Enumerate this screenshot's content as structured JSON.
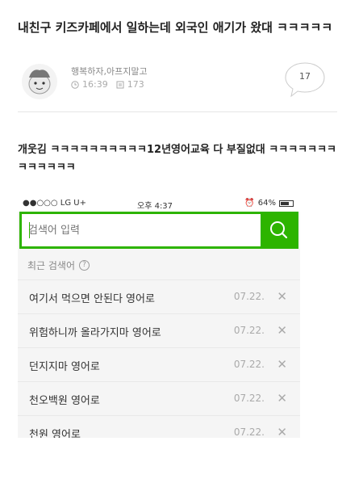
{
  "post": {
    "title": "내친구 키즈카페에서 일하는데 외국인 애기가 왔대 ㅋㅋㅋㅋㅋ",
    "author": "행복하자,아프지말고",
    "time": "16:39",
    "views": "173",
    "comments": "17",
    "body": "개웃김 ㅋㅋㅋㅋㅋㅋㅋㅋㅋㅋ12년영어교육 다 부질없대 ㅋㅋㅋㅋㅋㅋㅋㅋㅋㅋㅋㅋㅋ"
  },
  "phone": {
    "carrier": "●●○○○ LG U+",
    "clock": "오후 4:37",
    "battery": "64%",
    "search_placeholder": "검색어 입력",
    "recent_label": "최근 검색어",
    "help_glyph": "?",
    "accent": "#2db400",
    "history": [
      {
        "query": "여기서 먹으면 안된다 영어로",
        "date": "07.22."
      },
      {
        "query": "위험하니까 올라가지마 영어로",
        "date": "07.22."
      },
      {
        "query": "던지지마 영어로",
        "date": "07.22."
      },
      {
        "query": "천오백원 영어로",
        "date": "07.22."
      },
      {
        "query": "천원 영어로",
        "date": "07.22."
      }
    ],
    "delete_glyph": "✕"
  }
}
